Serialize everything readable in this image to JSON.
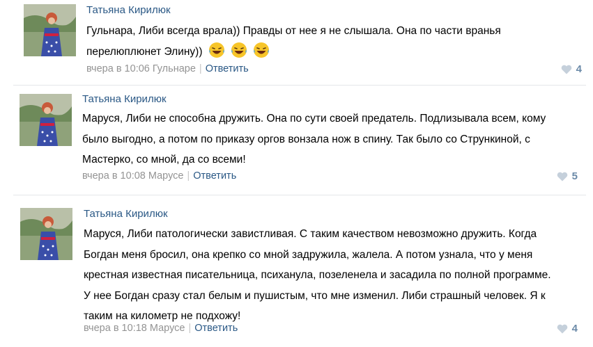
{
  "comments": [
    {
      "author": "Татьяна Кирилюк",
      "lines": [
        "Гульнара, Либи всегда врала)) Правды от нее я не слышала. Она по части вранья",
        "перелюплюнет Элину))"
      ],
      "emojis": [
        "laughing-with-tears-icon",
        "laughing-with-tears-icon",
        "laughing-with-tears-icon"
      ],
      "time": "вчера в 10:06 Гульнаре",
      "reply": "Ответить",
      "likes": "4"
    },
    {
      "author": "Татьяна Кирилюк",
      "lines": [
        "Маруся, Либи не способна дружить. Она по сути своей предатель. Подлизывала всем, кому",
        "было выгодно, а потом по приказу оргов вонзала нож в спину. Так было со Стрункиной, с",
        "Мастерко, со мной, да со всеми!"
      ],
      "time": "вчера в 10:08 Марусе",
      "reply": "Ответить",
      "likes": "5"
    },
    {
      "author": "Татьяна Кирилюк",
      "lines": [
        "Маруся, Либи патологически завистливая. С таким качеством невозможно дружить. Когда",
        "Богдан меня бросил, она крепко со мной задружила, жалела. А потом узнала, что у меня",
        "крестная известная писательница, психанула, позеленела и засадила по полной программе.",
        "У нее Богдан сразу стал белым и пушистым, что мне изменил. Либи страшный человек. Я к",
        "таким на километр не подхожу!"
      ],
      "time": "вчера в 10:18 Марусе",
      "reply": "Ответить",
      "likes": "4"
    }
  ],
  "colors": {
    "link": "#2a5885",
    "meta": "#939393",
    "like": "#6b8aa8"
  }
}
